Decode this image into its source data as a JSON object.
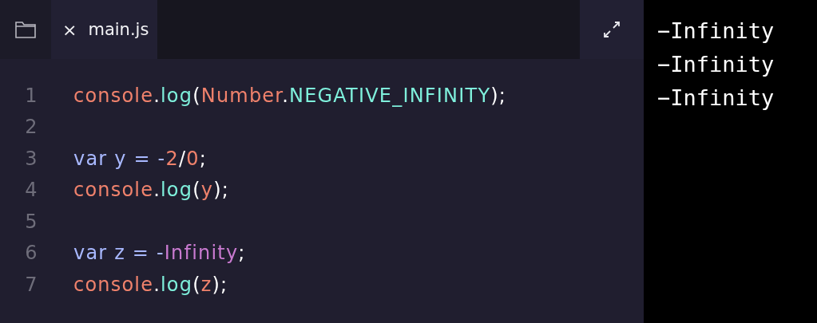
{
  "tab": {
    "label": "main.js",
    "close": "×"
  },
  "code_lines": [
    {
      "number": "1",
      "tokens": [
        {
          "text": "console",
          "kind": "object"
        },
        {
          "text": ".",
          "kind": "punct"
        },
        {
          "text": "log",
          "kind": "function"
        },
        {
          "text": "(",
          "kind": "punct"
        },
        {
          "text": "Number",
          "kind": "object"
        },
        {
          "text": ".",
          "kind": "punct"
        },
        {
          "text": "NEGATIVE_INFINITY",
          "kind": "function"
        },
        {
          "text": ");",
          "kind": "punct"
        }
      ]
    },
    {
      "number": "2"
    },
    {
      "number": "3",
      "tokens": [
        {
          "text": "var y = -",
          "kind": "keyword"
        },
        {
          "text": "2",
          "kind": "number"
        },
        {
          "text": "/",
          "kind": "punct"
        },
        {
          "text": "0",
          "kind": "number"
        },
        {
          "text": ";",
          "kind": "punct"
        }
      ]
    },
    {
      "number": "4",
      "tokens": [
        {
          "text": "console",
          "kind": "object"
        },
        {
          "text": ".",
          "kind": "punct"
        },
        {
          "text": "log",
          "kind": "function"
        },
        {
          "text": "(",
          "kind": "punct"
        },
        {
          "text": "y",
          "kind": "object"
        },
        {
          "text": ");",
          "kind": "punct"
        }
      ]
    },
    {
      "number": "5"
    },
    {
      "number": "6",
      "tokens": [
        {
          "text": "var z = -",
          "kind": "keyword"
        },
        {
          "text": "Infinity",
          "kind": "builtin"
        },
        {
          "text": ";",
          "kind": "punct"
        }
      ]
    },
    {
      "number": "7",
      "tokens": [
        {
          "text": "console",
          "kind": "object"
        },
        {
          "text": ".",
          "kind": "punct"
        },
        {
          "text": "log",
          "kind": "function"
        },
        {
          "text": "(",
          "kind": "punct"
        },
        {
          "text": "z",
          "kind": "object"
        },
        {
          "text": ");",
          "kind": "punct"
        }
      ]
    }
  ],
  "output": [
    "−Infinity",
    "−Infinity",
    "−Infinity"
  ]
}
